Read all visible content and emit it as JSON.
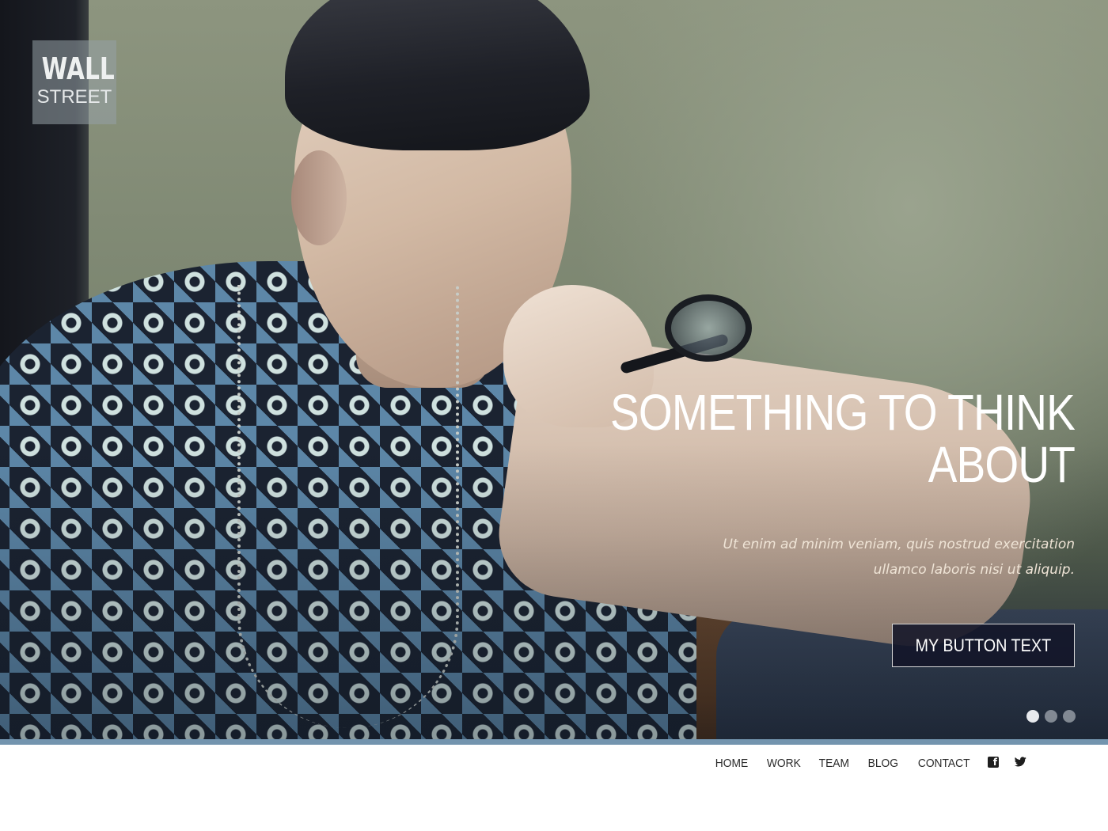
{
  "logo": {
    "line1": "WALL",
    "line2": "STREET"
  },
  "hero": {
    "headline_line1": "SOMETHING TO THINK",
    "headline_line2": "ABOUT",
    "subtext_line1": "Ut enim ad minim veniam, quis nostrud exercitation",
    "subtext_line2": "ullamco laboris nisi ut aliquip.",
    "button_label": "MY BUTTON TEXT",
    "slides": {
      "count": 3,
      "active_index": 1
    }
  },
  "nav": {
    "items": [
      {
        "label": "HOME"
      },
      {
        "label": "WORK"
      },
      {
        "label": "TEAM"
      },
      {
        "label": "BLOG"
      },
      {
        "label": "CONTACT"
      }
    ],
    "social": [
      {
        "icon": "facebook-icon",
        "glyph": "f"
      },
      {
        "icon": "twitter-icon"
      }
    ]
  },
  "colors": {
    "accent_stripe": "#7394ae",
    "button_background": "#121428",
    "text_light": "#ffffff",
    "nav_text": "#2a2a2a"
  }
}
